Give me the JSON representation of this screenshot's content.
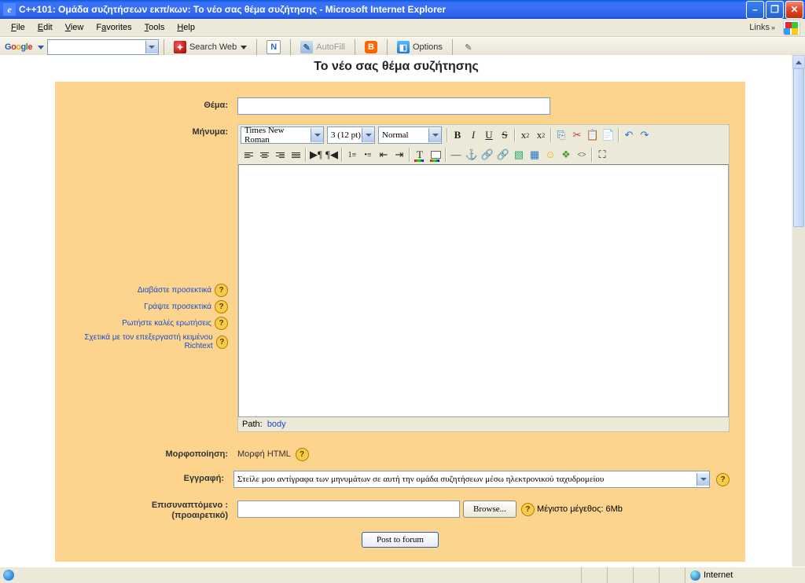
{
  "window": {
    "title": "C++101: Ομάδα συζητήσεων εκπ/κων: Το νέο σας θέμα συζήτησης - Microsoft Internet Explorer"
  },
  "menubar": {
    "file": "File",
    "edit": "Edit",
    "view": "View",
    "favorites": "Favorites",
    "tools": "Tools",
    "help": "Help",
    "links": "Links"
  },
  "google_toolbar": {
    "logo": "Google",
    "search_button": "Search Web",
    "autofill": "AutoFill",
    "options": "Options"
  },
  "page": {
    "title": "Το νέο σας θέμα συζήτησης",
    "labels": {
      "subject": "Θέμα:",
      "message": "Μήνυμα",
      "message_colon": "Μήνυμα:",
      "format": "Μορφοποίηση:",
      "subscribe": "Εγγραφή:",
      "attachment1": "Επισυναπτόμενο :",
      "attachment2": "(προαιρετικό)"
    },
    "help_links": {
      "h1": "Διαβάστε προσεκτικά",
      "h2": "Γράψτε προσεκτικά",
      "h3": "Ρωτήστε καλές ερωτήσεις",
      "h4": "Σχετικά με τον επεξεργαστή κειμένου Richtext"
    },
    "editor": {
      "font": "Times New Roman",
      "size": "3 (12 pt)",
      "style": "Normal",
      "path_label": "Path:",
      "path_value": "body"
    },
    "format_value": "Μορφή HTML",
    "subscribe_value": "Στείλε μου αντίγραφα των μηνυμάτων σε αυτή την ομάδα συζητήσεων μέσω ηλεκτρονικού ταχυδρομείου",
    "browse": "Browse...",
    "max_size": "Μέγιστο μέγεθος: 6Mb",
    "post_button": "Post to forum"
  },
  "statusbar": {
    "zone": "Internet"
  }
}
